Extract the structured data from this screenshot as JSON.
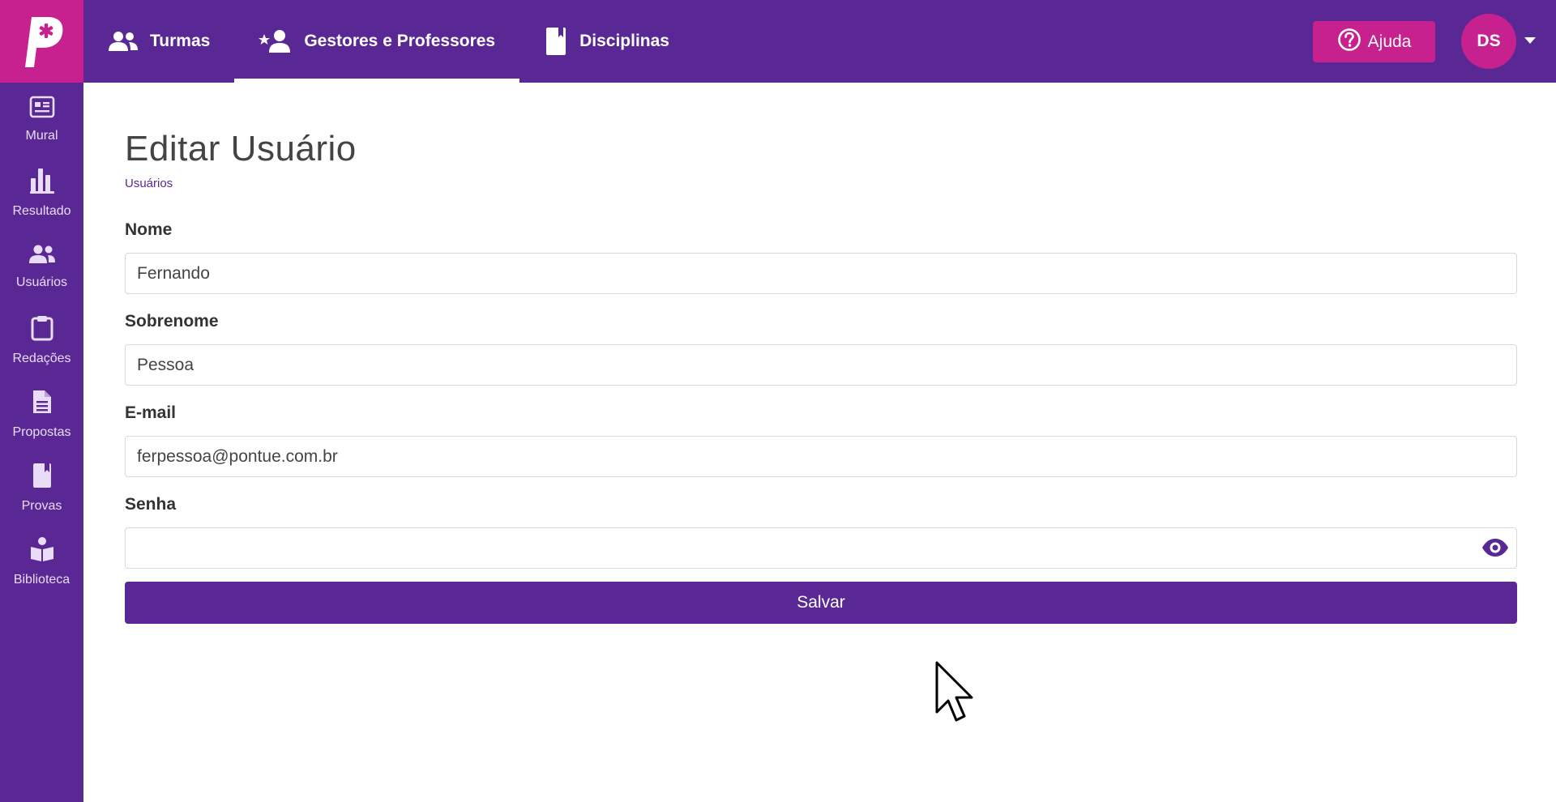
{
  "colors": {
    "primary": "#5a2895",
    "accent": "#c7208f",
    "white": "#ffffff"
  },
  "header": {
    "logo_icon": "pontue-p-logo-icon",
    "nav": [
      {
        "label": "Turmas",
        "icon": "users-icon",
        "active": false
      },
      {
        "label": "Gestores e Professores",
        "icon": "user-star-icon",
        "active": true
      },
      {
        "label": "Disciplinas",
        "icon": "book-icon",
        "active": false
      }
    ],
    "help_label": "Ajuda",
    "help_icon": "question-circle-icon",
    "avatar_initials": "DS",
    "avatar_caret_icon": "caret-down-icon"
  },
  "sidebar": {
    "items": [
      {
        "label": "Mural",
        "icon": "newspaper-icon"
      },
      {
        "label": "Resultado",
        "icon": "bar-chart-icon"
      },
      {
        "label": "Usuários",
        "icon": "users-icon"
      },
      {
        "label": "Redações",
        "icon": "clipboard-icon"
      },
      {
        "label": "Propostas",
        "icon": "file-text-icon"
      },
      {
        "label": "Provas",
        "icon": "book-icon"
      },
      {
        "label": "Biblioteca",
        "icon": "book-reader-icon"
      }
    ]
  },
  "page": {
    "title": "Editar Usuário",
    "breadcrumb": "Usuários"
  },
  "form": {
    "first_name_label": "Nome",
    "first_name_value": "Fernando",
    "last_name_label": "Sobrenome",
    "last_name_value": "Pessoa",
    "email_label": "E-mail",
    "email_value": "ferpessoa@pontue.com.br",
    "password_label": "Senha",
    "password_value": "",
    "password_toggle_icon": "eye-icon",
    "save_label": "Salvar"
  }
}
